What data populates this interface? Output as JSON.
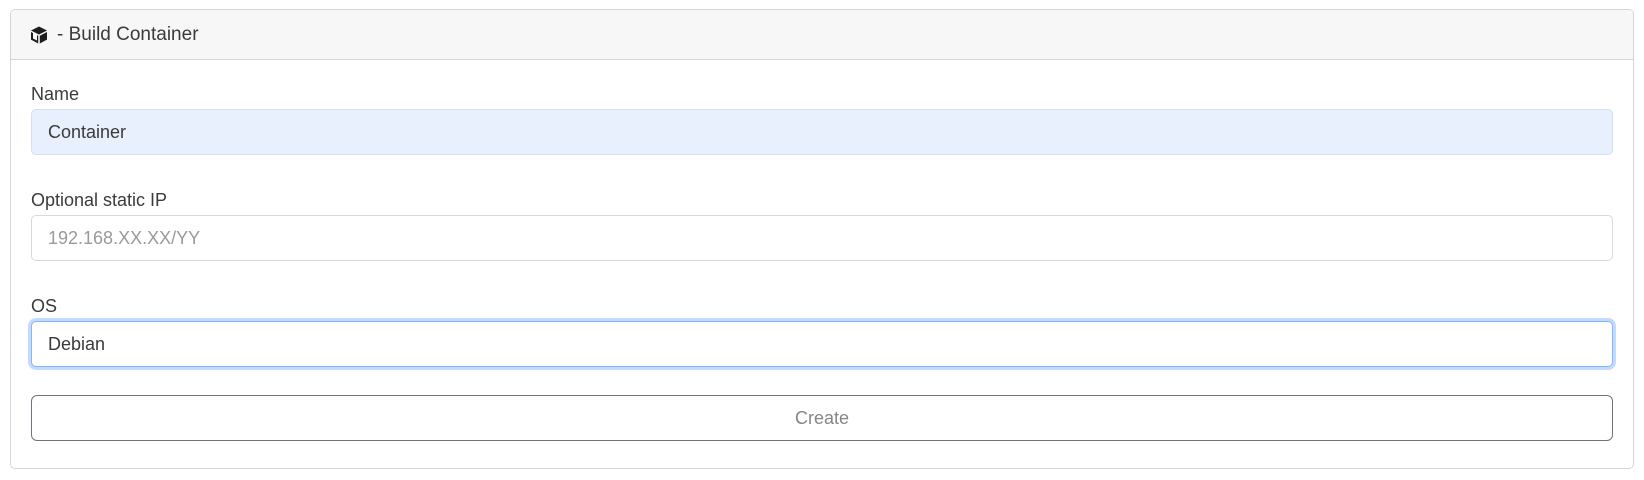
{
  "card": {
    "icon": "cube-icon",
    "title": "- Build Container"
  },
  "form": {
    "name": {
      "label": "Name",
      "value": "Container",
      "placeholder": ""
    },
    "static_ip": {
      "label": "Optional static IP",
      "value": "",
      "placeholder": "192.168.XX.XX/YY"
    },
    "os": {
      "label": "OS",
      "value": "Debian",
      "placeholder": ""
    },
    "submit_label": "Create"
  },
  "colors": {
    "header_bg": "#f7f7f7",
    "border": "#d6d6d6",
    "autofill_bg": "#e8f0fd",
    "focus_ring": "#86b7fe",
    "button_border": "#6c757d"
  }
}
